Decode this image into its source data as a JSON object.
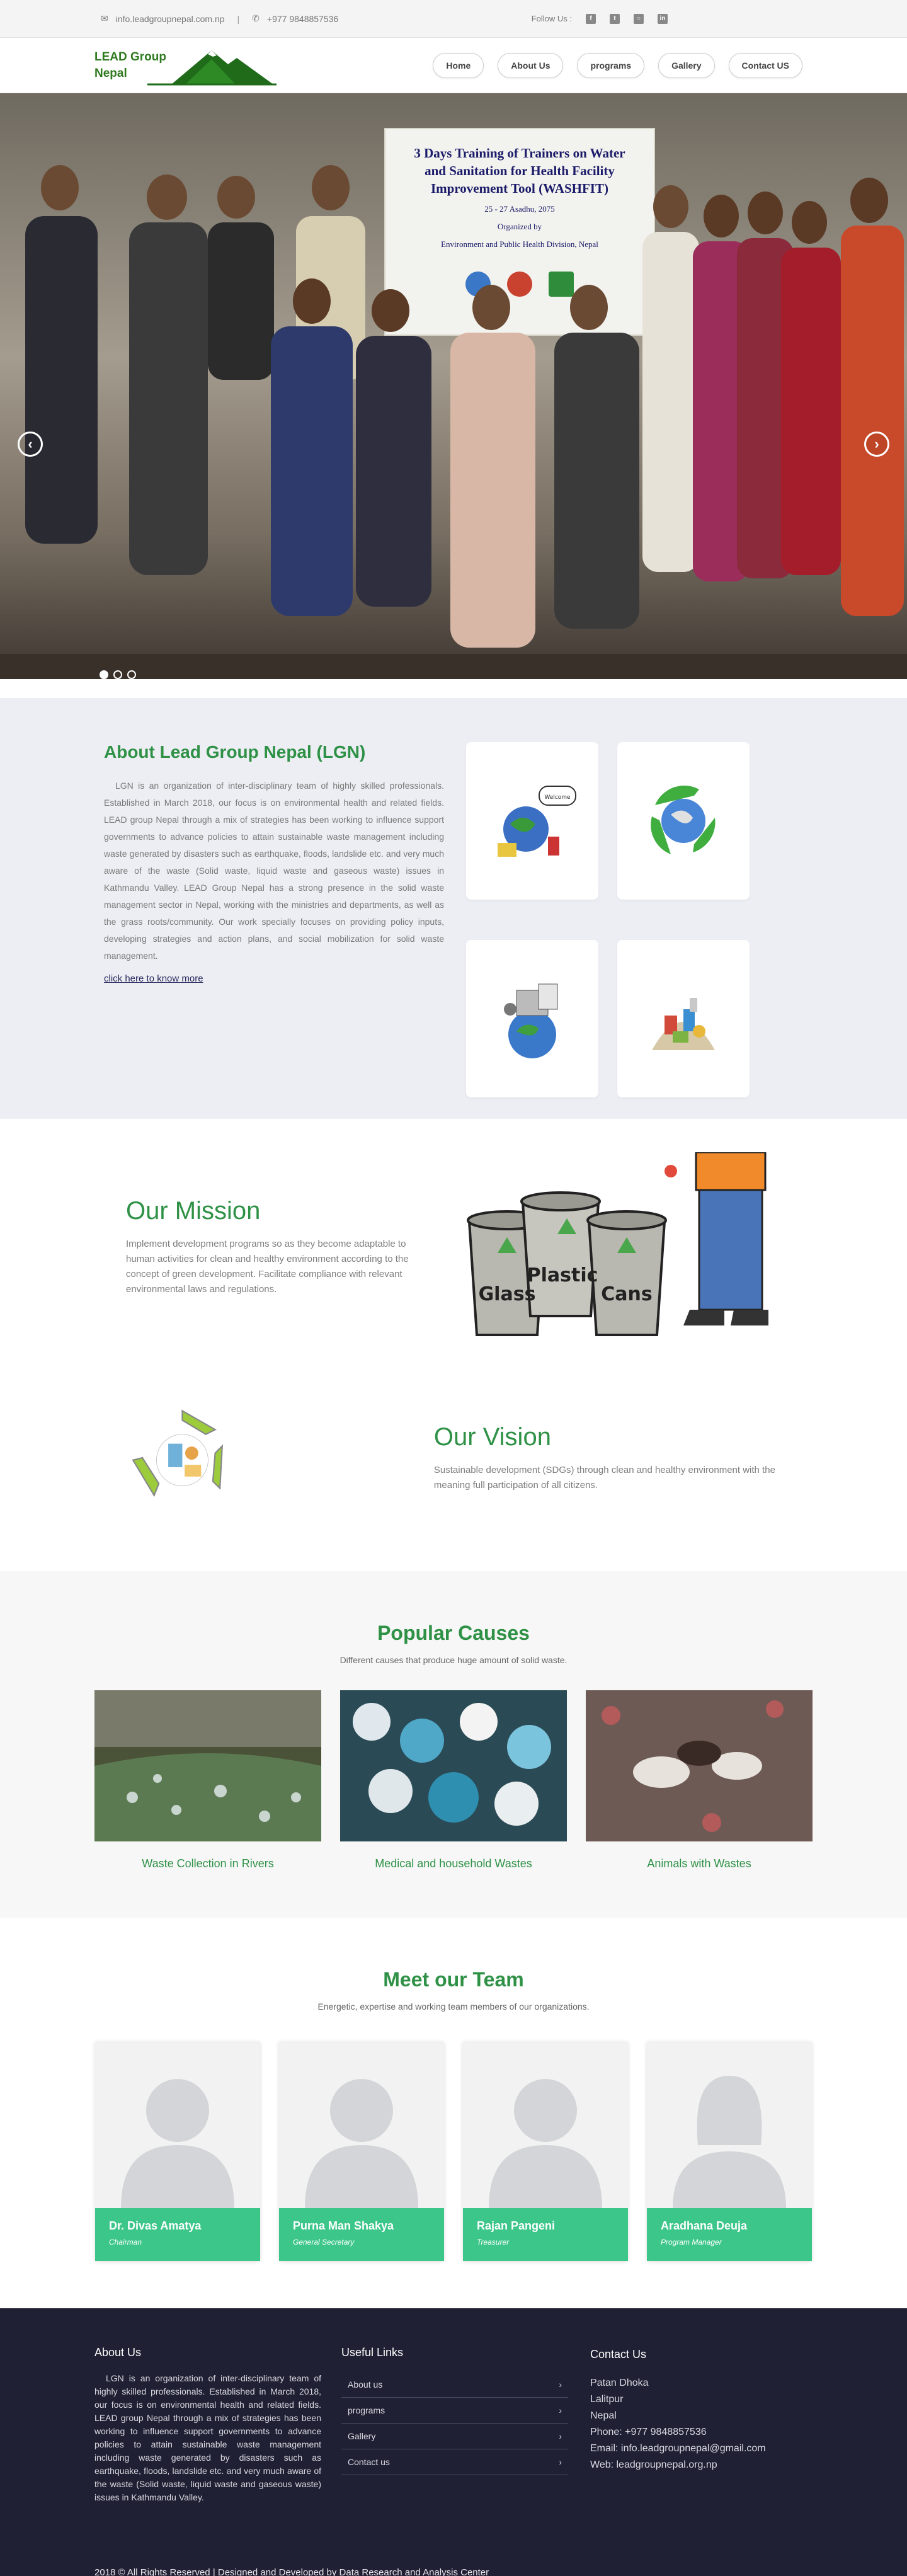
{
  "topbar": {
    "email": "info.leadgroupnepal.com.np",
    "separator": "|",
    "phone": "+977 9848857536",
    "follow_label": "Follow Us :",
    "socials": [
      "facebook-icon",
      "twitter-icon",
      "instagram-icon",
      "linkedin-icon"
    ]
  },
  "header": {
    "logo_line1": "LEAD Group",
    "logo_line2": "Nepal",
    "nav": [
      "Home",
      "About Us",
      "programs",
      "Gallery",
      "Contact US"
    ]
  },
  "hero": {
    "banner_title": "3 Days Training of Trainers on Water and Sanitation for Health Facility Improvement Tool (WASHFIT)",
    "banner_sub1": "25 - 27 Asadhu, 2075",
    "banner_sub2": "Organized by",
    "banner_sub3": "Environment and Public Health Division, Nepal",
    "slides": 3,
    "active_slide": 1
  },
  "about": {
    "title": "About Lead Group Nepal (LGN)",
    "text": "LGN is an organization of inter-disciplinary team of highly skilled professionals. Established in March 2018, our focus is on environmental health and related fields. LEAD group Nepal through a mix of strategies has been working to influence support governments to advance policies to attain sustainable waste management including waste generated by disasters such as earthquake, floods, landslide etc. and very much aware of the waste (Solid waste, liquid waste and gaseous waste) issues in Kathmandu Valley. LEAD Group Nepal has a strong presence in the solid waste management sector in Nepal, working with the ministries and departments, as well as the grass roots/community. Our work specially focuses on providing policy inputs, developing strategies and action plans, and social mobilization for solid waste management.",
    "more_link": "click here to know more",
    "welcome_bubble": "Welcome"
  },
  "mission": {
    "title": "Our Mission",
    "text": "Implement development programs so as they become adaptable to human activities for clean and healthy environment according to the concept of green development. Facilitate compliance with relevant environmental laws and regulations.",
    "bins": [
      "Glass",
      "Plastic",
      "Cans"
    ]
  },
  "vision": {
    "title": "Our Vision",
    "text": "Sustainable development (SDGs) through clean and healthy environment with the meaning full participation of all citizens."
  },
  "causes": {
    "title": "Popular Causes",
    "subtitle": "Different causes that produce huge amount of solid waste.",
    "items": [
      {
        "title": "Waste Collection in Rivers"
      },
      {
        "title": "Medical and household Wastes"
      },
      {
        "title": "Animals with Wastes"
      }
    ]
  },
  "team": {
    "title": "Meet our Team",
    "subtitle": "Energetic, expertise and working team members of our organizations.",
    "members": [
      {
        "name": "Dr. Divas Amatya",
        "role": "Chairman"
      },
      {
        "name": "Purna Man Shakya",
        "role": "General Secretary"
      },
      {
        "name": "Rajan Pangeni",
        "role": "Treasurer"
      },
      {
        "name": "Aradhana Deuja",
        "role": "Program Manager"
      }
    ]
  },
  "footer": {
    "about_title": "About Us",
    "about_text": "LGN is an organization of inter-disciplinary team of highly skilled professionals. Established in March 2018, our focus is on environmental health and related fields. LEAD group Nepal through a mix of strategies has been working to influence support governments to advance policies to attain sustainable waste management including waste generated by disasters such as earthquake, floods, landslide etc. and very much aware of the waste (Solid waste, liquid waste and gaseous waste) issues in Kathmandu Valley.",
    "links_title": "Useful Links",
    "links": [
      "About us",
      "programs",
      "Gallery",
      "Contact us"
    ],
    "contact_title": "Contact Us",
    "contact_lines": [
      "Patan Dhoka",
      "Lalitpur",
      "Nepal",
      "Phone: +977 9848857536",
      "Email: info.leadgroupnepal@gmail.com",
      "Web: leadgroupnepal.org.np"
    ],
    "copyright": "2018 © All Rights Reserved | Designed and Developed by Data Research and Analysis Center"
  },
  "colors": {
    "accent_green": "#2e9146",
    "team_card": "#3cc68a",
    "footer_bg": "#1f2033"
  }
}
